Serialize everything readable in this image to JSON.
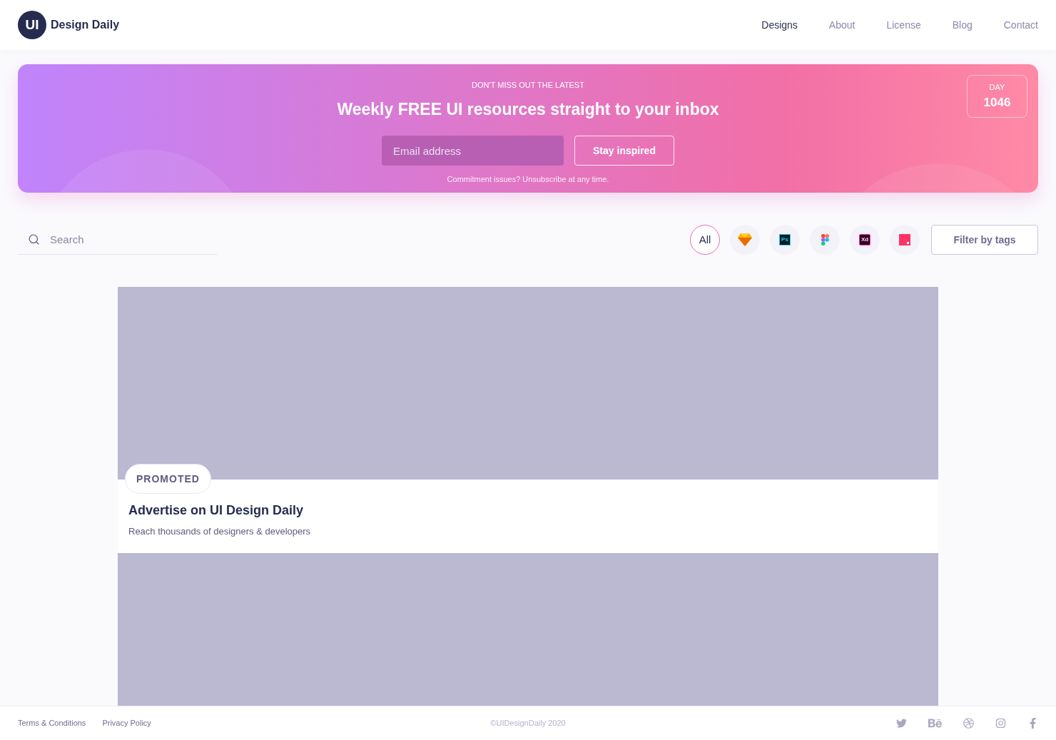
{
  "header": {
    "logo_mark": "UI",
    "logo_text": "Design Daily",
    "nav": [
      {
        "label": "Designs",
        "selected": true
      },
      {
        "label": "About",
        "selected": false
      },
      {
        "label": "License",
        "selected": false
      },
      {
        "label": "Blog",
        "selected": false
      },
      {
        "label": "Contact",
        "selected": false
      }
    ]
  },
  "banner": {
    "eyebrow": "DON'T MISS OUT THE LATEST",
    "title": "Weekly FREE UI resources straight to your inbox",
    "email": {
      "placeholder": "Email address"
    },
    "button": "Stay inspired",
    "note": "Commitment issues? Unsubscribe at any time.",
    "day_label": "DAY",
    "day_number": "1046"
  },
  "search": {
    "placeholder": "Search"
  },
  "filters": [
    {
      "kind": "text",
      "label": "All",
      "selected": true
    },
    {
      "kind": "sketch",
      "selected": false
    },
    {
      "kind": "ps",
      "label": "Ps",
      "selected": false
    },
    {
      "kind": "figma",
      "selected": false
    },
    {
      "kind": "xd",
      "label": "Xd",
      "selected": false
    },
    {
      "kind": "invision",
      "selected": false
    }
  ],
  "filter_button": "Filter by tags",
  "cards": [
    {
      "kind": "promoted",
      "badge": "PROMOTED",
      "title": "Advertise on UI Design Daily",
      "subtitle": "Reach thousands of designers & developers"
    },
    {
      "kind": "image"
    }
  ],
  "footer": {
    "links": [
      "Terms & Conditions",
      "Privacy Policy"
    ],
    "copyright": "©UIDesignDaily 2020"
  }
}
